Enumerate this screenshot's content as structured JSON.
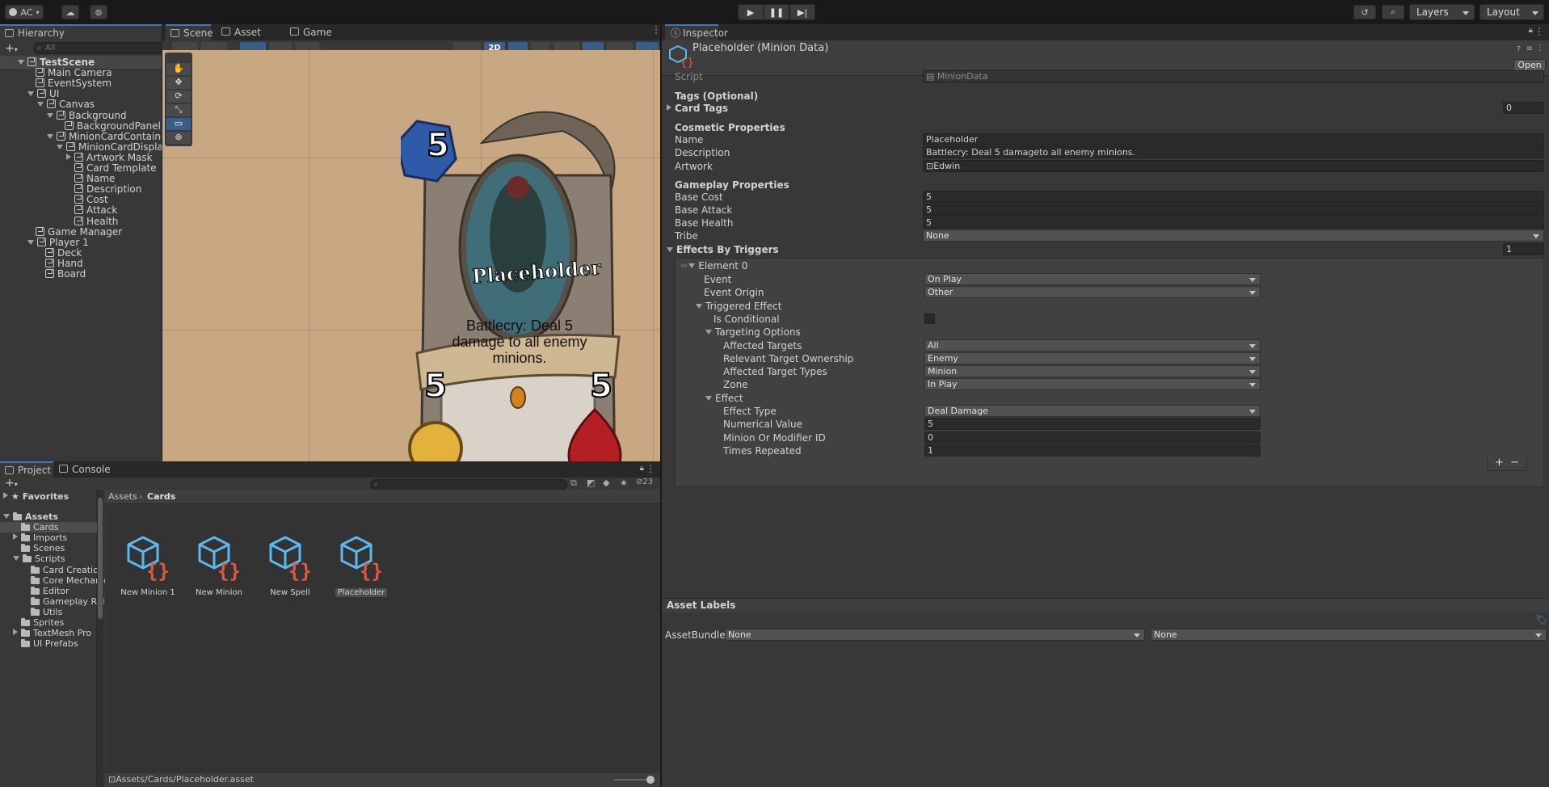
{
  "toolbar": {
    "account": "AC",
    "layers": "Layers",
    "layout": "Layout"
  },
  "hierarchy": {
    "tab": "Hierarchy",
    "search_placeholder": "All",
    "items": [
      {
        "label": "TestScene",
        "depth": 0,
        "arrow": "down",
        "bold": true
      },
      {
        "label": "Main Camera",
        "depth": 1,
        "arrow": ""
      },
      {
        "label": "EventSystem",
        "depth": 1,
        "arrow": ""
      },
      {
        "label": "UI",
        "depth": 1,
        "arrow": "down"
      },
      {
        "label": "Canvas",
        "depth": 2,
        "arrow": "down"
      },
      {
        "label": "Background",
        "depth": 3,
        "arrow": "down"
      },
      {
        "label": "BackgroundPanel",
        "depth": 4,
        "arrow": ""
      },
      {
        "label": "MinionCardContainerTe",
        "depth": 3,
        "arrow": "down"
      },
      {
        "label": "MinionCardDisplay",
        "depth": 4,
        "arrow": "down"
      },
      {
        "label": "Artwork Mask",
        "depth": 5,
        "arrow": "right"
      },
      {
        "label": "Card Template",
        "depth": 5,
        "arrow": ""
      },
      {
        "label": "Name",
        "depth": 5,
        "arrow": ""
      },
      {
        "label": "Description",
        "depth": 5,
        "arrow": ""
      },
      {
        "label": "Cost",
        "depth": 5,
        "arrow": ""
      },
      {
        "label": "Attack",
        "depth": 5,
        "arrow": ""
      },
      {
        "label": "Health",
        "depth": 5,
        "arrow": ""
      },
      {
        "label": "Game Manager",
        "depth": 1,
        "arrow": ""
      },
      {
        "label": "Player 1",
        "depth": 1,
        "arrow": "down"
      },
      {
        "label": "Deck",
        "depth": 2,
        "arrow": ""
      },
      {
        "label": "Hand",
        "depth": 2,
        "arrow": ""
      },
      {
        "label": "Board",
        "depth": 2,
        "arrow": ""
      }
    ]
  },
  "scene": {
    "tabs": [
      "Scene",
      "Asset Store",
      "Game"
    ],
    "mode_2d": "2D",
    "card": {
      "cost": "5",
      "name": "Placeholder",
      "description": "Battlecry: Deal 5 damage to all enemy minions.",
      "attack": "5",
      "health": "5"
    }
  },
  "inspector": {
    "tab": "Inspector",
    "title": "Placeholder (Minion Data)",
    "open_button": "Open",
    "script_label": "Script",
    "script_value": "MinionData",
    "tags_header": "Tags (Optional)",
    "card_tags_label": "Card Tags",
    "card_tags_count": "0",
    "cosmetic_header": "Cosmetic Properties",
    "name_label": "Name",
    "name_value": "Placeholder",
    "description_label": "Description",
    "description_value": "Battlecry: Deal 5 damageto all enemy minions.",
    "artwork_label": "Artwork",
    "artwork_value": "Edwin",
    "gameplay_header": "Gameplay Properties",
    "base_cost_label": "Base Cost",
    "base_cost_value": "5",
    "base_attack_label": "Base Attack",
    "base_attack_value": "5",
    "base_health_label": "Base Health",
    "base_health_value": "5",
    "tribe_label": "Tribe",
    "tribe_value": "None",
    "effects_label": "Effects By Triggers",
    "effects_count": "1",
    "element_label": "Element 0",
    "event_label": "Event",
    "event_value": "On Play",
    "event_origin_label": "Event Origin",
    "event_origin_value": "Other",
    "triggered_effect_label": "Triggered Effect",
    "is_conditional_label": "Is Conditional",
    "targeting_options_label": "Targeting Options",
    "affected_targets_label": "Affected Targets",
    "affected_targets_value": "All",
    "relevant_ownership_label": "Relevant Target Ownership",
    "relevant_ownership_value": "Enemy",
    "affected_types_label": "Affected Target Types",
    "affected_types_value": "Minion",
    "zone_label": "Zone",
    "zone_value": "In Play",
    "effect_label": "Effect",
    "effect_type_label": "Effect Type",
    "effect_type_value": "Deal Damage",
    "numerical_value_label": "Numerical Value",
    "numerical_value": "5",
    "minion_modifier_label": "Minion Or Modifier ID",
    "minion_modifier_value": "0",
    "times_repeated_label": "Times Repeated",
    "times_repeated_value": "1",
    "asset_labels": "Asset Labels",
    "assetbundle_label": "AssetBundle",
    "assetbundle_value": "None",
    "assetbundle_variant": "None"
  },
  "project": {
    "tabs": [
      "Project",
      "Console"
    ],
    "hidden_count": "23",
    "breadcrumb_root": "Assets",
    "breadcrumb_current": "Cards",
    "favorites": "Favorites",
    "tree": [
      {
        "label": "Assets",
        "depth": 0,
        "arrow": "down",
        "bold": true
      },
      {
        "label": "Cards",
        "depth": 1,
        "arrow": "",
        "selected": true
      },
      {
        "label": "Imports",
        "depth": 1,
        "arrow": "right"
      },
      {
        "label": "Scenes",
        "depth": 1,
        "arrow": ""
      },
      {
        "label": "Scripts",
        "depth": 1,
        "arrow": "down"
      },
      {
        "label": "Card Creation",
        "depth": 2,
        "arrow": ""
      },
      {
        "label": "Core Mechanic",
        "depth": 2,
        "arrow": ""
      },
      {
        "label": "Editor",
        "depth": 2,
        "arrow": ""
      },
      {
        "label": "Gameplay Rela",
        "depth": 2,
        "arrow": ""
      },
      {
        "label": "Utils",
        "depth": 2,
        "arrow": ""
      },
      {
        "label": "Sprites",
        "depth": 1,
        "arrow": ""
      },
      {
        "label": "TextMesh Pro",
        "depth": 1,
        "arrow": "right"
      },
      {
        "label": "UI Prefabs",
        "depth": 1,
        "arrow": ""
      }
    ],
    "assets": [
      "New Minion 1",
      "New Minion",
      "New Spell",
      "Placeholder"
    ],
    "selected_path": "Assets/Cards/Placeholder.asset"
  }
}
